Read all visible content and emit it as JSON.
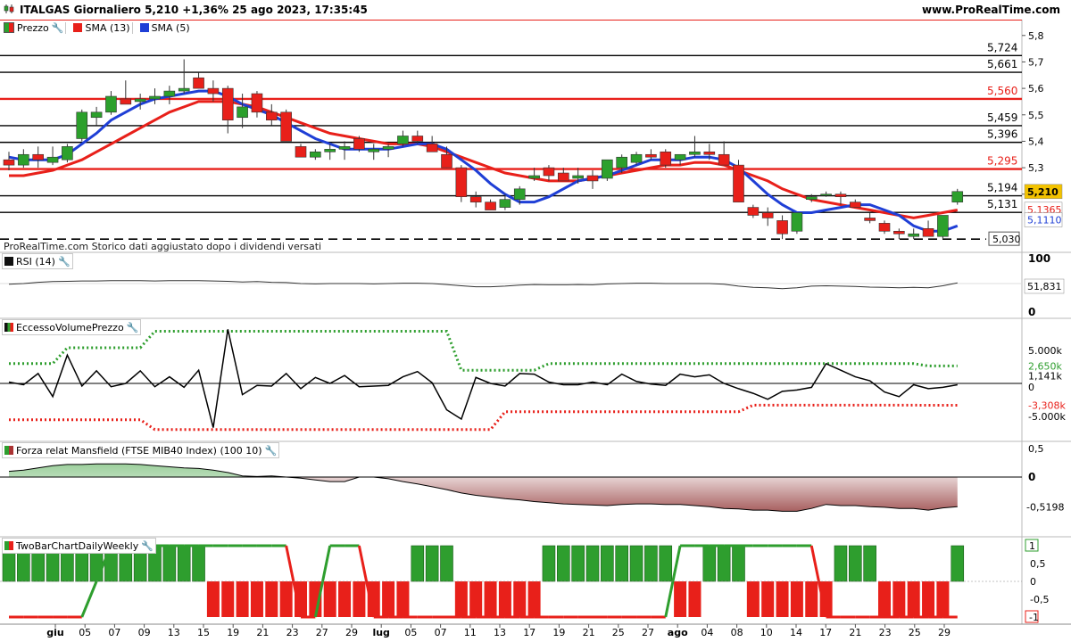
{
  "header": {
    "title": "ITALGAS Giornaliero 5,210 +1,36% 25 ago 2023, 17:35:45",
    "site": "www.ProRealTime.com"
  },
  "legend": {
    "price": "Prezzo",
    "sma13": "SMA (13)",
    "sma5": "SMA (5)"
  },
  "panels": {
    "rsi": "RSI (14)",
    "evp": "EccessoVolumePrezzo",
    "mansfield": "Forza relat Mansfield (FTSE MIB40 Index) (100 10)",
    "twobar": "TwoBarChartDailyWeekly"
  },
  "note": "ProRealTime.com Storico dati aggiustato dopo i dividendi versati",
  "colors": {
    "up": "#2ca02c",
    "down": "#e8201a",
    "sma13": "#e8201a",
    "sma5": "#1f3fd6",
    "price_tag": "#f2c200",
    "green_dot": "#2e9e2e",
    "red_dot": "#e8201a"
  },
  "chart_data": {
    "type": "candlestick",
    "x_ticks": [
      "giu",
      "05",
      "07",
      "09",
      "13",
      "15",
      "19",
      "21",
      "23",
      "27",
      "29",
      "lug",
      "05",
      "07",
      "11",
      "13",
      "17",
      "19",
      "21",
      "25",
      "27",
      "ago",
      "04",
      "08",
      "10",
      "14",
      "17",
      "21",
      "23",
      "25",
      "29"
    ],
    "price_axis": {
      "ylim": [
        4.98,
        5.86
      ],
      "ticks": [
        "5,8",
        "5,7",
        "5,6",
        "5,5",
        "5,4",
        "5,3",
        "5,2"
      ]
    },
    "levels": [
      {
        "value": 5.724,
        "label": "5,724",
        "color": "black"
      },
      {
        "value": 5.661,
        "label": "5,661",
        "color": "black"
      },
      {
        "value": 5.56,
        "label": "5,560",
        "color": "red"
      },
      {
        "value": 5.459,
        "label": "5,459",
        "color": "black"
      },
      {
        "value": 5.396,
        "label": "5,396",
        "color": "black"
      },
      {
        "value": 5.295,
        "label": "5,295",
        "color": "red"
      },
      {
        "value": 5.194,
        "label": "5,194",
        "color": "black"
      },
      {
        "value": 5.131,
        "label": "5,131",
        "color": "black"
      },
      {
        "value": 5.03,
        "label": "5,030",
        "color": "dashed"
      }
    ],
    "last_price": {
      "value": 5.21,
      "label": "5,210"
    },
    "sma13_last": {
      "value": 5.1365,
      "label": "5,1365"
    },
    "sma5_last": {
      "value": 5.111,
      "label": "5,1110"
    },
    "candles": [
      [
        5.33,
        5.36,
        5.29,
        5.31
      ],
      [
        5.31,
        5.37,
        5.3,
        5.35
      ],
      [
        5.35,
        5.38,
        5.3,
        5.33
      ],
      [
        5.32,
        5.38,
        5.31,
        5.34
      ],
      [
        5.33,
        5.39,
        5.32,
        5.38
      ],
      [
        5.41,
        5.52,
        5.4,
        5.51
      ],
      [
        5.49,
        5.53,
        5.46,
        5.51
      ],
      [
        5.51,
        5.59,
        5.5,
        5.57
      ],
      [
        5.56,
        5.63,
        5.55,
        5.54
      ],
      [
        5.55,
        5.58,
        5.52,
        5.56
      ],
      [
        5.56,
        5.6,
        5.54,
        5.57
      ],
      [
        5.57,
        5.61,
        5.54,
        5.59
      ],
      [
        5.59,
        5.71,
        5.58,
        5.6
      ],
      [
        5.64,
        5.66,
        5.6,
        5.6
      ],
      [
        5.6,
        5.63,
        5.55,
        5.58
      ],
      [
        5.6,
        5.61,
        5.43,
        5.48
      ],
      [
        5.49,
        5.58,
        5.45,
        5.53
      ],
      [
        5.58,
        5.59,
        5.49,
        5.51
      ],
      [
        5.51,
        5.54,
        5.46,
        5.48
      ],
      [
        5.51,
        5.52,
        5.4,
        5.4
      ],
      [
        5.38,
        5.39,
        5.34,
        5.34
      ],
      [
        5.34,
        5.37,
        5.33,
        5.36
      ],
      [
        5.36,
        5.39,
        5.33,
        5.37
      ],
      [
        5.37,
        5.4,
        5.33,
        5.38
      ],
      [
        5.41,
        5.42,
        5.36,
        5.37
      ],
      [
        5.36,
        5.39,
        5.33,
        5.37
      ],
      [
        5.37,
        5.39,
        5.34,
        5.38
      ],
      [
        5.39,
        5.44,
        5.38,
        5.42
      ],
      [
        5.42,
        5.44,
        5.39,
        5.4
      ],
      [
        5.39,
        5.42,
        5.36,
        5.36
      ],
      [
        5.35,
        5.38,
        5.3,
        5.3
      ],
      [
        5.3,
        5.31,
        5.17,
        5.19
      ],
      [
        5.19,
        5.21,
        5.15,
        5.17
      ],
      [
        5.17,
        5.18,
        5.14,
        5.14
      ],
      [
        5.15,
        5.2,
        5.14,
        5.18
      ],
      [
        5.18,
        5.23,
        5.16,
        5.22
      ],
      [
        5.26,
        5.3,
        5.25,
        5.27
      ],
      [
        5.3,
        5.31,
        5.25,
        5.27
      ],
      [
        5.28,
        5.3,
        5.25,
        5.25
      ],
      [
        5.26,
        5.3,
        5.24,
        5.27
      ],
      [
        5.27,
        5.29,
        5.22,
        5.25
      ],
      [
        5.26,
        5.33,
        5.25,
        5.33
      ],
      [
        5.3,
        5.35,
        5.28,
        5.34
      ],
      [
        5.32,
        5.36,
        5.31,
        5.35
      ],
      [
        5.35,
        5.37,
        5.33,
        5.34
      ],
      [
        5.36,
        5.37,
        5.3,
        5.31
      ],
      [
        5.33,
        5.35,
        5.31,
        5.35
      ],
      [
        5.35,
        5.42,
        5.34,
        5.36
      ],
      [
        5.36,
        5.39,
        5.33,
        5.35
      ],
      [
        5.35,
        5.4,
        5.31,
        5.31
      ],
      [
        5.31,
        5.33,
        5.17,
        5.17
      ],
      [
        5.15,
        5.16,
        5.11,
        5.12
      ],
      [
        5.13,
        5.15,
        5.08,
        5.11
      ],
      [
        5.1,
        5.12,
        5.03,
        5.05
      ],
      [
        5.06,
        5.12,
        5.05,
        5.13
      ],
      [
        5.18,
        5.2,
        5.17,
        5.19
      ],
      [
        5.2,
        5.21,
        5.19,
        5.2
      ],
      [
        5.2,
        5.21,
        5.16,
        5.19
      ],
      [
        5.17,
        5.18,
        5.15,
        5.15
      ],
      [
        5.11,
        5.13,
        5.09,
        5.1
      ],
      [
        5.09,
        5.1,
        5.05,
        5.06
      ],
      [
        5.06,
        5.07,
        5.03,
        5.05
      ],
      [
        5.04,
        5.07,
        5.03,
        5.05
      ],
      [
        5.07,
        5.1,
        5.04,
        5.04
      ],
      [
        5.04,
        5.12,
        5.03,
        5.12
      ],
      [
        5.17,
        5.22,
        5.16,
        5.21
      ]
    ],
    "sma13": [
      5.27,
      5.27,
      5.28,
      5.29,
      5.31,
      5.33,
      5.36,
      5.39,
      5.42,
      5.45,
      5.48,
      5.51,
      5.53,
      5.55,
      5.55,
      5.55,
      5.54,
      5.53,
      5.51,
      5.49,
      5.47,
      5.45,
      5.43,
      5.42,
      5.41,
      5.4,
      5.39,
      5.39,
      5.39,
      5.38,
      5.36,
      5.34,
      5.32,
      5.3,
      5.28,
      5.27,
      5.26,
      5.25,
      5.25,
      5.25,
      5.26,
      5.27,
      5.28,
      5.29,
      5.3,
      5.31,
      5.31,
      5.32,
      5.32,
      5.31,
      5.29,
      5.27,
      5.25,
      5.22,
      5.2,
      5.18,
      5.17,
      5.16,
      5.15,
      5.14,
      5.13,
      5.12,
      5.11,
      5.12,
      5.13,
      5.14
    ],
    "sma5": [
      5.34,
      5.33,
      5.33,
      5.33,
      5.35,
      5.39,
      5.43,
      5.48,
      5.51,
      5.54,
      5.56,
      5.57,
      5.58,
      5.59,
      5.59,
      5.57,
      5.54,
      5.52,
      5.5,
      5.47,
      5.44,
      5.41,
      5.39,
      5.37,
      5.37,
      5.37,
      5.37,
      5.38,
      5.39,
      5.39,
      5.37,
      5.33,
      5.29,
      5.24,
      5.2,
      5.17,
      5.17,
      5.19,
      5.22,
      5.25,
      5.26,
      5.27,
      5.29,
      5.31,
      5.33,
      5.33,
      5.33,
      5.34,
      5.34,
      5.33,
      5.3,
      5.25,
      5.2,
      5.16,
      5.13,
      5.13,
      5.14,
      5.15,
      5.16,
      5.16,
      5.14,
      5.12,
      5.08,
      5.06,
      5.06,
      5.08,
      5.11
    ],
    "rsi": {
      "last_label": "51,831",
      "ticks": [
        "100",
        "0"
      ],
      "values": [
        48,
        50,
        54,
        56,
        57,
        58,
        58,
        59,
        59,
        59,
        58,
        59,
        59,
        59,
        58,
        57,
        55,
        56,
        54,
        53,
        50,
        49,
        50,
        50,
        50,
        49,
        50,
        51,
        51,
        50,
        47,
        43,
        40,
        40,
        42,
        45,
        47,
        46,
        46,
        47,
        46,
        49,
        50,
        51,
        51,
        50,
        50,
        50,
        50,
        48,
        42,
        38,
        37,
        34,
        37,
        42,
        43,
        42,
        41,
        39,
        38,
        37,
        38,
        37,
        43,
        52
      ]
    },
    "evp": {
      "labels": {
        "top": "5.000k",
        "green_level": "2,650k",
        "value": "1,141k",
        "zero": "0",
        "red_level": "-3,308k",
        "bottom": "-5.000k"
      },
      "green_level_value": 2650,
      "red_level_value": -3308,
      "line": [
        200,
        -200,
        1500,
        -2000,
        4300,
        -400,
        1900,
        -500,
        0,
        1900,
        -500,
        1000,
        -600,
        2000,
        -6700,
        8200,
        -1700,
        -300,
        -400,
        1500,
        -800,
        900,
        0,
        1200,
        -500,
        -400,
        -300,
        1000,
        1800,
        100,
        -4000,
        -5400,
        900,
        0,
        -400,
        1500,
        1400,
        200,
        -200,
        -200,
        200,
        -200,
        1400,
        300,
        -100,
        -300,
        1400,
        1000,
        1300,
        0,
        -800,
        -1500,
        -2400,
        -1200,
        -1000,
        -600,
        3000,
        2000,
        1000,
        400,
        -1300,
        -2000,
        -200,
        -800,
        -600,
        -200,
        2900,
        900,
        1141
      ],
      "green_upper": [
        3000,
        3000,
        3000,
        3000,
        5400,
        5400,
        5400,
        5400,
        5400,
        5400,
        7900,
        7900,
        7900,
        7900,
        7900,
        7900,
        7900,
        7900,
        7900,
        7900,
        7900,
        7900,
        7900,
        7900,
        7900,
        7900,
        7900,
        7900,
        7900,
        7900,
        7900,
        2000,
        2000,
        2000,
        2000,
        2000,
        2000,
        3000,
        3000,
        3000,
        3000,
        3000,
        3000,
        3000,
        3000,
        3000,
        3000,
        3000,
        3000,
        3000,
        3000,
        3000,
        3000,
        3000,
        3000,
        3000,
        3000,
        3000,
        3000,
        3000,
        3000,
        3000,
        3000,
        2650,
        2650,
        2650,
        2650,
        2650,
        2650
      ],
      "red_lower": [
        -5500,
        -5500,
        -5500,
        -5500,
        -5500,
        -5500,
        -5500,
        -5500,
        -5500,
        -5500,
        -7000,
        -7000,
        -7000,
        -7000,
        -7000,
        -7000,
        -7000,
        -7000,
        -7000,
        -7000,
        -7000,
        -7000,
        -7000,
        -7000,
        -7000,
        -7000,
        -7000,
        -7000,
        -7000,
        -7000,
        -7000,
        -7000,
        -7000,
        -7000,
        -4300,
        -4300,
        -4300,
        -4300,
        -4300,
        -4300,
        -4300,
        -4300,
        -4300,
        -4300,
        -4300,
        -4300,
        -4300,
        -4300,
        -4300,
        -4300,
        -4300,
        -3300,
        -3300,
        -3300,
        -3300,
        -3300,
        -3300,
        -3300,
        -3300,
        -3300,
        -3300,
        -3300,
        -3300,
        -3308,
        -3308,
        -3308,
        -3308,
        -3308,
        -3308
      ]
    },
    "mansfield": {
      "last_label": "-0,5198",
      "ticks": [
        "0,5",
        "0"
      ],
      "values": [
        0.1,
        0.12,
        0.16,
        0.2,
        0.22,
        0.22,
        0.23,
        0.23,
        0.23,
        0.22,
        0.2,
        0.18,
        0.16,
        0.15,
        0.12,
        0.08,
        0.02,
        0.01,
        0.02,
        0.0,
        -0.02,
        -0.05,
        -0.08,
        -0.08,
        0.0,
        0.0,
        -0.03,
        -0.08,
        -0.12,
        -0.17,
        -0.22,
        -0.28,
        -0.32,
        -0.35,
        -0.38,
        -0.4,
        -0.43,
        -0.45,
        -0.47,
        -0.48,
        -0.49,
        -0.5,
        -0.48,
        -0.47,
        -0.47,
        -0.48,
        -0.48,
        -0.5,
        -0.52,
        -0.55,
        -0.56,
        -0.58,
        -0.58,
        -0.6,
        -0.6,
        -0.55,
        -0.48,
        -0.5,
        -0.5,
        -0.52,
        -0.53,
        -0.55,
        -0.55,
        -0.58,
        -0.54,
        -0.52
      ]
    },
    "twobar": {
      "ticks": [
        "1",
        "0,5",
        "0",
        "-0,5",
        "-1"
      ],
      "bars": [
        1,
        1,
        1,
        1,
        1,
        1,
        1,
        1,
        1,
        1,
        1,
        1,
        1,
        1,
        -1,
        -1,
        -1,
        -1,
        -1,
        -1,
        -1,
        -1,
        -1,
        -1,
        -1,
        -1,
        -1,
        -1,
        1,
        1,
        1,
        -1,
        -1,
        -1,
        -1,
        -1,
        -1,
        1,
        1,
        1,
        1,
        1,
        1,
        1,
        1,
        1,
        -1,
        -1,
        1,
        1,
        1,
        -1,
        -1,
        -1,
        -1,
        -1,
        -1,
        1,
        1,
        1,
        -1,
        -1,
        -1,
        -1,
        -1,
        1,
        1,
        1
      ],
      "line": [
        -1,
        -1,
        -1,
        -1,
        -1,
        -1,
        0.0,
        1,
        1,
        1,
        1,
        1,
        1,
        1,
        1,
        1,
        1,
        1,
        1,
        1,
        -1,
        -1,
        1,
        1,
        1,
        -1,
        -1,
        -1,
        -1,
        -1,
        -1,
        -1,
        -1,
        -1,
        -1,
        -1,
        -1,
        -1,
        -1,
        -1,
        -1,
        -1,
        -1,
        -1,
        -1,
        -1,
        1,
        1,
        1,
        1,
        1,
        1,
        1,
        1,
        1,
        1,
        -1,
        -1,
        -1,
        -1,
        -1,
        -1,
        -1,
        -1,
        -1,
        -1,
        -1,
        -1,
        -1,
        -1
      ]
    }
  }
}
